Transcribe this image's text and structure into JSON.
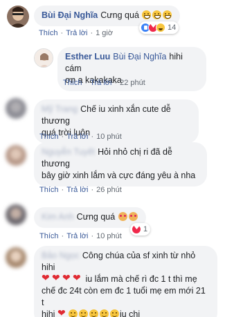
{
  "actions": {
    "like": "Thích",
    "reply": "Trả lời"
  },
  "comments": [
    {
      "author": "Bùi Đại Nghĩa",
      "text": "Cưng quá",
      "time": "1 giờ",
      "reactions": [
        "like-reaction",
        "love-reaction",
        "haha-reaction"
      ],
      "reaction_count": "14",
      "emoji": [
        "grin",
        "grin",
        "grin"
      ]
    },
    {
      "author": "Esther Luu",
      "tag": "Bùi Đại Nghĩa",
      "text_line1": "hihi cám",
      "text_line2": "ơn a kakakaka",
      "time": "22 phút"
    },
    {
      "author": "Mỹ Trang",
      "text_line1": "Chế iu xinh xắn cute dễ thương",
      "text_line2": "quá trời luôn",
      "time": "10 phút"
    },
    {
      "author": "Nguyễn Tuyết",
      "text_line1": "Hỏi nhỏ chị ri đã dễ thương",
      "text_line2": "bây giờ xinh lắm và cực đáng yêu à nha",
      "time": "26 phút"
    },
    {
      "author": "Kim Anh",
      "text": "Cưng quá",
      "time": "10 phút",
      "reaction_count": "1"
    },
    {
      "author": "Bảo Ngọc",
      "text_line1": "Công chúa của sf xinh từ nhỏ hihi",
      "text_line2": "iu lắm mà chế rì đc 1 t thì mẹ",
      "text_line3": "chế đc 24t còn em đc 1 tuổi mẹ em mới 21 t",
      "text_line4a": "hihi",
      "text_line4b": "iu chị",
      "time": "10 phút"
    }
  ],
  "colors": {
    "link": "#385898",
    "bubble": "#f2f3f5",
    "meta": "#606770"
  }
}
